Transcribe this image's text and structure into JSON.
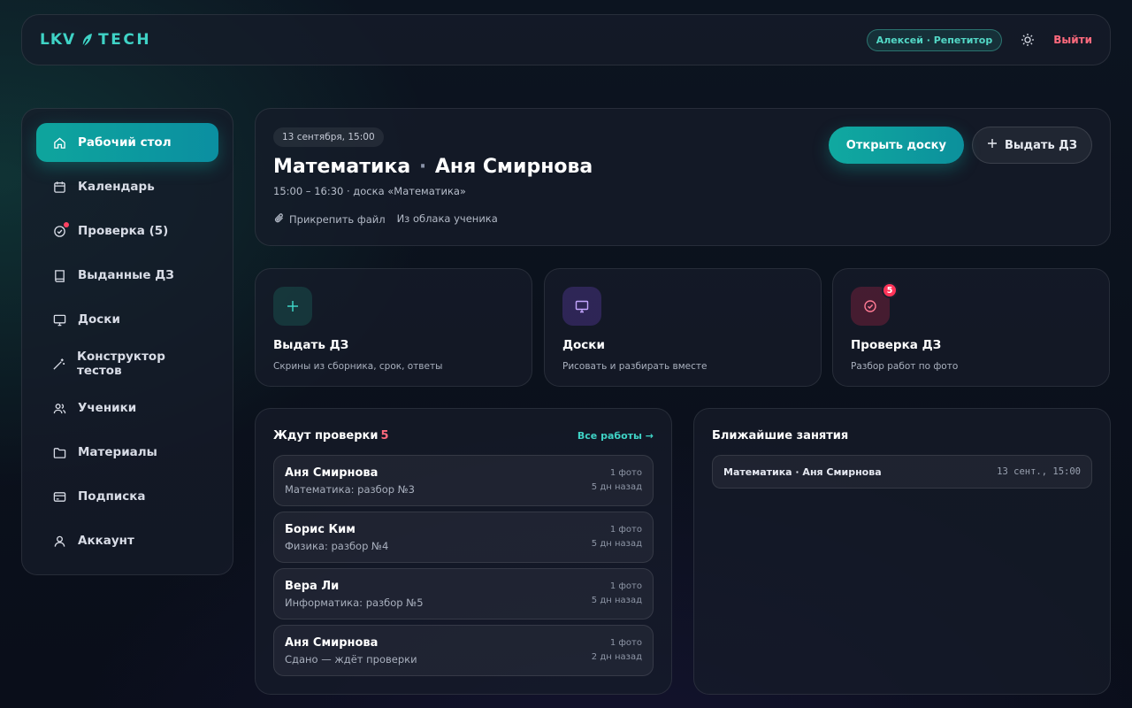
{
  "brand": {
    "left": "LKV",
    "right": "TECH",
    "icon": "leaf-icon",
    "color": "#3fd3c6"
  },
  "header": {
    "user": "Алексей · Репетитор",
    "theme_icon": "sun-icon",
    "logout": "Выйти"
  },
  "sidebar": {
    "items": [
      {
        "label": "Рабочий стол",
        "icon": "home-icon",
        "active": true
      },
      {
        "label": "Календарь",
        "icon": "calendar-icon"
      },
      {
        "label": "Проверка (5)",
        "icon": "check-circle-icon",
        "dot": true
      },
      {
        "label": "Выданные ДЗ",
        "icon": "book-icon"
      },
      {
        "label": "Доски",
        "icon": "monitor-icon"
      },
      {
        "label": "Конструктор тестов",
        "icon": "wand-icon"
      },
      {
        "label": "Ученики",
        "icon": "users-icon"
      },
      {
        "label": "Материалы",
        "icon": "folder-icon"
      },
      {
        "label": "Подписка",
        "icon": "card-icon"
      },
      {
        "label": "Аккаунт",
        "icon": "user-icon"
      }
    ]
  },
  "lesson": {
    "date": "13 сентября, 15:00",
    "subject": "Математика",
    "student": "Аня Смирнова",
    "separator": "·",
    "details": "15:00 – 16:30 · доска «Математика»",
    "attach_label": "Прикрепить файл",
    "cloud_label": "Из облака ученика",
    "open_board_label": "Открыть доску",
    "assign_label": "Выдать ДЗ"
  },
  "tiles": [
    {
      "title": "Выдать ДЗ",
      "desc": "Скрины из сборника, срок, ответы",
      "icon": "plus-icon"
    },
    {
      "title": "Доски",
      "desc": "Рисовать и разбирать вместе",
      "icon": "monitor-icon"
    },
    {
      "title": "Проверка ДЗ",
      "desc": "Разбор работ по фото",
      "icon": "check-circle-icon",
      "badge": "5"
    }
  ],
  "waiting": {
    "title": "Ждут проверки",
    "count": "5",
    "all_link": "Все работы →",
    "items": [
      {
        "name": "Аня Смирнова",
        "sub": "Математика: разбор №3",
        "photos": "1 фото",
        "ago": "5 дн назад"
      },
      {
        "name": "Борис Ким",
        "sub": "Физика: разбор №4",
        "photos": "1 фото",
        "ago": "5 дн назад"
      },
      {
        "name": "Вера Ли",
        "sub": "Информатика: разбор №5",
        "photos": "1 фото",
        "ago": "5 дн назад"
      },
      {
        "name": "Аня Смирнова",
        "sub": "Сдано — ждёт проверки",
        "photos": "1 фото",
        "ago": "2 дн назад"
      }
    ]
  },
  "upcoming": {
    "title": "Ближайшие занятия",
    "items": [
      {
        "name": "Математика · Аня Смирнова",
        "time": "13 сент., 15:00"
      }
    ]
  }
}
